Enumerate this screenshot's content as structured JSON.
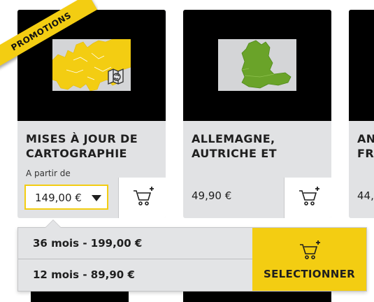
{
  "cards": [
    {
      "ribbon": "PROMOTIONS",
      "title": "MISES À JOUR DE\nCARTOGRAPHIE",
      "price_label": "A partir de",
      "price_selected": "149,00 €",
      "map_icon": "europe-map-update-icon"
    },
    {
      "title": "ALLEMAGNE,\nAUTRICHE ET",
      "price": "49,90 €",
      "map_icon": "germany-austria-map-icon"
    },
    {
      "title": "AN\nFR",
      "price": "44,",
      "map_icon": "map-icon"
    }
  ],
  "dropdown": {
    "options": [
      "36 mois - 199,00 €",
      "12 mois - 89,90 €"
    ],
    "select_button_label": "SELECTIONNER"
  },
  "colors": {
    "accent_yellow": "#f3cd12",
    "card_bg": "#e1e2e4",
    "map_green": "#6aa329",
    "map_yellow": "#f3cd12"
  }
}
